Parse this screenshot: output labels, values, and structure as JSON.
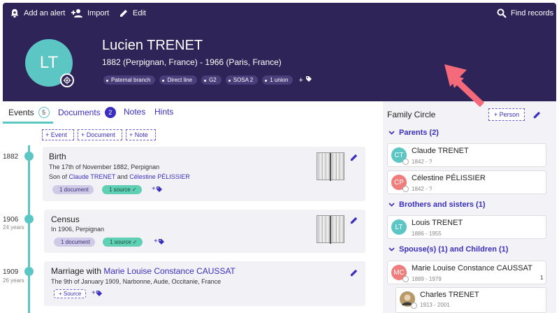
{
  "toolbar": {
    "add_alert": "Add an alert",
    "import": "Import",
    "edit": "Edit",
    "find_records": "Find records"
  },
  "person": {
    "initials": "LT",
    "name": "Lucien TRENET",
    "dates": "1882 (Perpignan, France) - 1966 (Paris, France)",
    "tags": [
      "Paternal branch",
      "Direct line",
      "G2",
      "SOSA 2",
      "1 union"
    ]
  },
  "tabs": {
    "events": "Events",
    "events_count": "5",
    "documents": "Documents",
    "documents_count": "2",
    "notes": "Notes",
    "hints": "Hints"
  },
  "add_buttons": {
    "event": "+ Event",
    "document": "+ Document",
    "note": "+ Note"
  },
  "events": [
    {
      "year": "1882",
      "age": "",
      "title": "Birth",
      "line1": "The 17th of November 1882, Perpignan",
      "son_of": "Son of ",
      "parent1": "Claude TRENET",
      "and": " and ",
      "parent2": "Célestine PÉLISSIER",
      "documents": "1 document",
      "sources": "1 source ✓"
    },
    {
      "year": "1906",
      "age": "24 years",
      "title": "Census",
      "line1": "In 1906, Perpignan",
      "documents": "1 document",
      "sources": "1 source ✓"
    },
    {
      "year": "1909",
      "age": "26 years",
      "title_prefix": "Marriage with ",
      "title_link": "Marie Louise Constance CAUSSAT",
      "line1": "The 9th of January 1909, Narbonne, Aude, Occitanie, France",
      "source_button": "+ Source"
    }
  ],
  "family": {
    "title": "Family Circle",
    "add_person": "+ Person",
    "parents_heading": "Parents (2)",
    "parents": [
      {
        "initials": "CT",
        "name": "Claude TRENET",
        "dates": "1842 - ?",
        "color": "#5cc6c4"
      },
      {
        "initials": "CP",
        "name": "Célestine PÉLISSIER",
        "dates": "1842 - ?",
        "color": "#f07c7c"
      }
    ],
    "siblings_heading": "Brothers and sisters (1)",
    "siblings": [
      {
        "initials": "LT",
        "name": "Louis TRENET",
        "dates": "1886 - 1955",
        "color": "#5cc6c4"
      }
    ],
    "spouses_heading": "Spouse(s) (1) and Children (1)",
    "spouses": [
      {
        "initials": "MC",
        "name": "Marie Louise Constance CAUSSAT",
        "dates": "1889 - 1979",
        "color": "#f07c7c",
        "count": "1"
      }
    ],
    "children": [
      {
        "name": "Charles TRENET",
        "dates": "1913 - 2001"
      }
    ]
  },
  "colors": {
    "header_bg": "#2e2457",
    "accent": "#3a2ec0",
    "teal": "#5cc6c4",
    "pink": "#f07c7c",
    "annotation_arrow": "#f46a7a"
  }
}
